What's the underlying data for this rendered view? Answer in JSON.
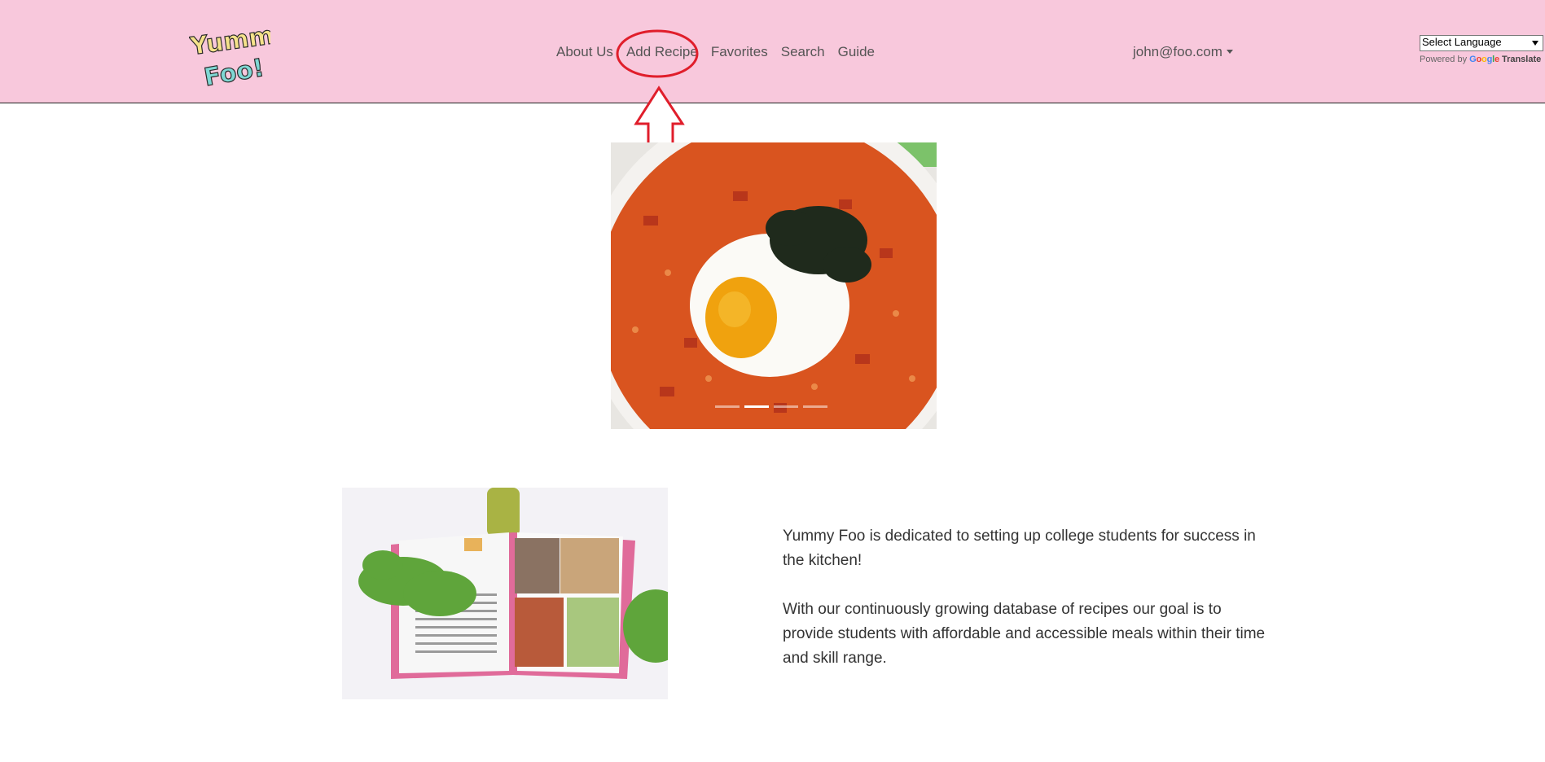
{
  "brand": {
    "logo_top": "Yummy",
    "logo_bottom": "Foo!"
  },
  "nav": {
    "items": [
      "About Us",
      "Add Recipe",
      "Favorites",
      "Search",
      "Guide"
    ]
  },
  "user": {
    "email": "john@foo.com"
  },
  "translate": {
    "select_label": "Select Language",
    "powered_by": "Powered by",
    "google": [
      "G",
      "o",
      "o",
      "g",
      "l",
      "e"
    ],
    "link": "Translate"
  },
  "carousel": {
    "slide_count": 4,
    "active_index": 1
  },
  "about": {
    "paragraph_1": "Yummy Foo is dedicated to setting up college students for success in the kitchen!",
    "paragraph_2": "With our continuously growing database of recipes our goal is to provide students with affordable and accessible meals within their time and skill range."
  },
  "colors": {
    "navbar_bg": "#f8c8dc",
    "annotation_red": "#e01e2b"
  }
}
